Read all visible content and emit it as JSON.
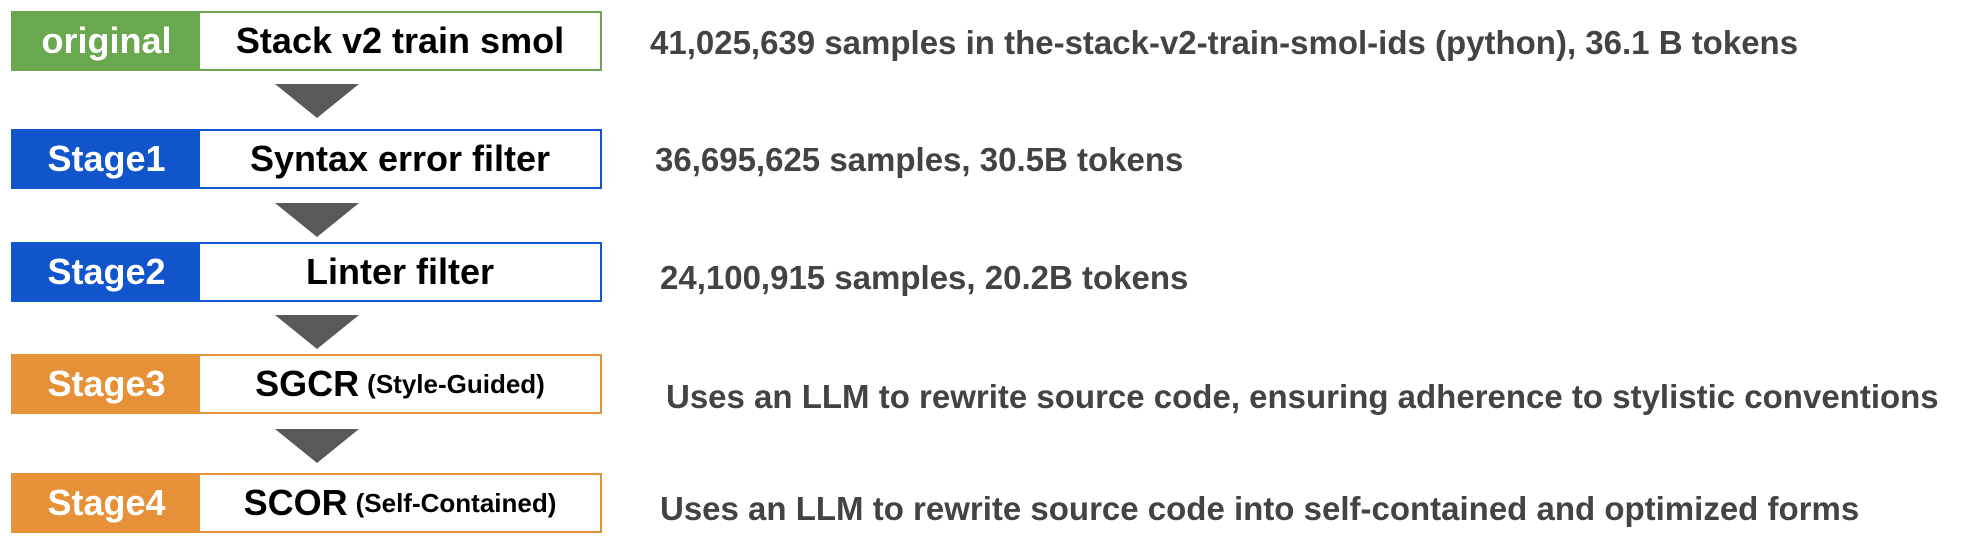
{
  "stages": [
    {
      "badge": "original",
      "title": "Stack v2 train smol",
      "subtitle": "",
      "description": "41,025,639 samples in the-stack-v2-train-smol-ids (python), 36.1 B tokens",
      "color": "#6aa84f"
    },
    {
      "badge": "Stage1",
      "title": "Syntax error filter",
      "subtitle": "",
      "description": "36,695,625 samples, 30.5B tokens",
      "color": "#1155cc"
    },
    {
      "badge": "Stage2",
      "title": "Linter filter",
      "subtitle": "",
      "description": "24,100,915 samples, 20.2B tokens",
      "color": "#1155cc"
    },
    {
      "badge": "Stage3",
      "title": "SGCR",
      "subtitle": "(Style-Guided)",
      "description": "Uses an LLM to rewrite source code, ensuring adherence to stylistic conventions",
      "color": "#e69138"
    },
    {
      "badge": "Stage4",
      "title": "SCOR",
      "subtitle": "(Self-Contained)",
      "description": "Uses an LLM to rewrite source code into self-contained and optimized forms",
      "color": "#e69138"
    }
  ],
  "arrow_color": "#595959"
}
